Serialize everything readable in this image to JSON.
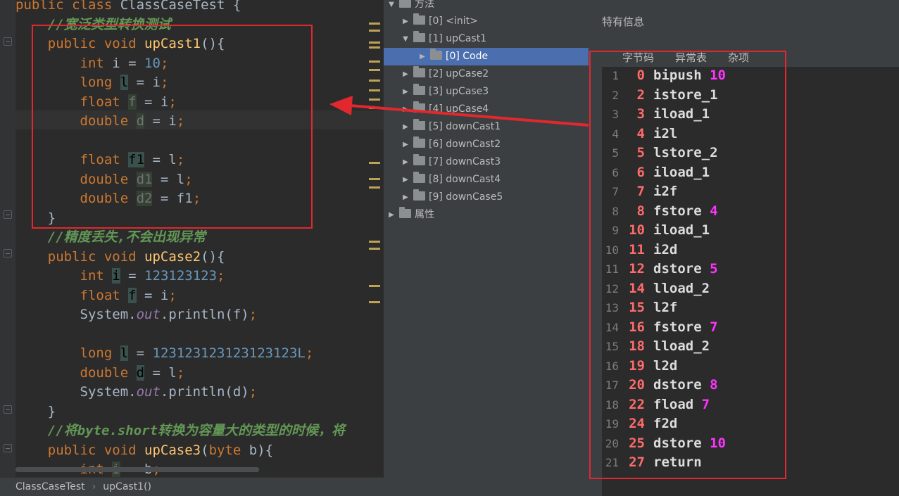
{
  "editor": {
    "code_lines": [
      [
        [
          "kw",
          "public "
        ],
        [
          "kw",
          "class "
        ],
        [
          "id",
          "ClassCaseTest {"
        ]
      ],
      [
        [
          "id",
          "    "
        ],
        [
          "cm",
          "//宽泛类型转换测试"
        ]
      ],
      [
        [
          "id",
          "    "
        ],
        [
          "kw",
          "public "
        ],
        [
          "kw",
          "void "
        ],
        [
          "fn",
          "upCast1"
        ],
        [
          "id",
          "(){"
        ]
      ],
      [
        [
          "id",
          "        "
        ],
        [
          "kw",
          "int "
        ],
        [
          "id",
          "i = "
        ],
        [
          "num",
          "10"
        ],
        [
          "kw",
          ";"
        ]
      ],
      [
        [
          "id",
          "        "
        ],
        [
          "kw",
          "long "
        ],
        [
          "hl",
          "l"
        ],
        [
          "id",
          " = i"
        ],
        [
          "kw",
          ";"
        ]
      ],
      [
        [
          "id",
          "        "
        ],
        [
          "kw",
          "float "
        ],
        [
          "unused",
          "f"
        ],
        [
          "id",
          " = i"
        ],
        [
          "kw",
          ";"
        ]
      ],
      [
        [
          "id",
          "        "
        ],
        [
          "kw",
          "double "
        ],
        [
          "unused",
          "d"
        ],
        [
          "id",
          " = i"
        ],
        [
          "kw",
          ";"
        ]
      ],
      [
        [
          "id",
          ""
        ]
      ],
      [
        [
          "id",
          "        "
        ],
        [
          "kw",
          "float "
        ],
        [
          "hl",
          "f1"
        ],
        [
          "id",
          " = l"
        ],
        [
          "kw",
          ";"
        ]
      ],
      [
        [
          "id",
          "        "
        ],
        [
          "kw",
          "double "
        ],
        [
          "unused",
          "d1"
        ],
        [
          "id",
          " = l"
        ],
        [
          "kw",
          ";"
        ]
      ],
      [
        [
          "id",
          "        "
        ],
        [
          "kw",
          "double "
        ],
        [
          "unused",
          "d2"
        ],
        [
          "id",
          " = f1"
        ],
        [
          "kw",
          ";"
        ]
      ],
      [
        [
          "id",
          "    }"
        ]
      ],
      [
        [
          "id",
          "    "
        ],
        [
          "cm",
          "//精度丢失,不会出现异常"
        ]
      ],
      [
        [
          "id",
          "    "
        ],
        [
          "kw",
          "public "
        ],
        [
          "kw",
          "void "
        ],
        [
          "fn",
          "upCase2"
        ],
        [
          "id",
          "(){"
        ]
      ],
      [
        [
          "id",
          "        "
        ],
        [
          "kw",
          "int "
        ],
        [
          "hl",
          "i"
        ],
        [
          "id",
          " = "
        ],
        [
          "num",
          "123123123"
        ],
        [
          "kw",
          ";"
        ]
      ],
      [
        [
          "id",
          "        "
        ],
        [
          "kw",
          "float "
        ],
        [
          "hl",
          "f"
        ],
        [
          "id",
          " = i"
        ],
        [
          "kw",
          ";"
        ]
      ],
      [
        [
          "id",
          "        System."
        ],
        [
          "fld",
          "out"
        ],
        [
          "id",
          ".println(f)"
        ],
        [
          "kw",
          ";"
        ]
      ],
      [
        [
          "id",
          ""
        ]
      ],
      [
        [
          "id",
          "        "
        ],
        [
          "kw",
          "long "
        ],
        [
          "hl",
          "l"
        ],
        [
          "id",
          " = "
        ],
        [
          "num",
          "123123123123123123L"
        ],
        [
          "kw",
          ";"
        ]
      ],
      [
        [
          "id",
          "        "
        ],
        [
          "kw",
          "double "
        ],
        [
          "hl",
          "d"
        ],
        [
          "id",
          " = l"
        ],
        [
          "kw",
          ";"
        ]
      ],
      [
        [
          "id",
          "        System."
        ],
        [
          "fld",
          "out"
        ],
        [
          "id",
          ".println(d)"
        ],
        [
          "kw",
          ";"
        ]
      ],
      [
        [
          "id",
          "    }"
        ]
      ],
      [
        [
          "id",
          "    "
        ],
        [
          "cm",
          "//将byte.short转换为容量大的类型的时候，将"
        ]
      ],
      [
        [
          "id",
          "    "
        ],
        [
          "kw",
          "public "
        ],
        [
          "kw",
          "void "
        ],
        [
          "fn",
          "upCase3"
        ],
        [
          "id",
          "("
        ],
        [
          "kw",
          "byte "
        ],
        [
          "id",
          "b){"
        ]
      ],
      [
        [
          "id",
          "        "
        ],
        [
          "kw",
          "int "
        ],
        [
          "unused",
          "i"
        ],
        [
          "id",
          " = b"
        ],
        [
          "kw",
          ";"
        ]
      ]
    ]
  },
  "breadcrumb": {
    "class_name": "ClassCaseTest",
    "method_name": "upCast1()"
  },
  "tree": {
    "root_label": "方法",
    "items": [
      {
        "label": "[0] <init>",
        "expanded": false,
        "selected": false
      },
      {
        "label": "[1] upCast1",
        "expanded": true,
        "selected": false
      },
      {
        "label": "[0] Code",
        "expanded": false,
        "selected": true
      },
      {
        "label": "[2] upCase2",
        "expanded": false,
        "selected": false
      },
      {
        "label": "[3] upCase3",
        "expanded": false,
        "selected": false
      },
      {
        "label": "[4] upCase4",
        "expanded": false,
        "selected": false
      },
      {
        "label": "[5] downCast1",
        "expanded": false,
        "selected": false
      },
      {
        "label": "[6] downCast2",
        "expanded": false,
        "selected": false
      },
      {
        "label": "[7] downCast3",
        "expanded": false,
        "selected": false
      },
      {
        "label": "[8] downCast4",
        "expanded": false,
        "selected": false
      },
      {
        "label": "[9] downCase5",
        "expanded": false,
        "selected": false
      },
      {
        "label": "属性",
        "expanded": false,
        "selected": false
      }
    ]
  },
  "detail": {
    "title": "特有信息",
    "tabs": [
      "字节码",
      "异常表",
      "杂项"
    ],
    "active_tab": "字节码",
    "bytecode": [
      {
        "ln": "1",
        "offset": "0",
        "op": "bipush",
        "arg": "10"
      },
      {
        "ln": "2",
        "offset": "2",
        "op": "istore_1",
        "arg": ""
      },
      {
        "ln": "3",
        "offset": "3",
        "op": "iload_1",
        "arg": ""
      },
      {
        "ln": "4",
        "offset": "4",
        "op": "i2l",
        "arg": ""
      },
      {
        "ln": "5",
        "offset": "5",
        "op": "lstore_2",
        "arg": ""
      },
      {
        "ln": "6",
        "offset": "6",
        "op": "iload_1",
        "arg": ""
      },
      {
        "ln": "7",
        "offset": "7",
        "op": "i2f",
        "arg": ""
      },
      {
        "ln": "8",
        "offset": "8",
        "op": "fstore",
        "arg": "4"
      },
      {
        "ln": "9",
        "offset": "10",
        "op": "iload_1",
        "arg": ""
      },
      {
        "ln": "10",
        "offset": "11",
        "op": "i2d",
        "arg": ""
      },
      {
        "ln": "11",
        "offset": "12",
        "op": "dstore",
        "arg": "5"
      },
      {
        "ln": "12",
        "offset": "14",
        "op": "lload_2",
        "arg": ""
      },
      {
        "ln": "13",
        "offset": "15",
        "op": "l2f",
        "arg": ""
      },
      {
        "ln": "14",
        "offset": "16",
        "op": "fstore",
        "arg": "7"
      },
      {
        "ln": "15",
        "offset": "18",
        "op": "lload_2",
        "arg": ""
      },
      {
        "ln": "16",
        "offset": "19",
        "op": "l2d",
        "arg": ""
      },
      {
        "ln": "17",
        "offset": "20",
        "op": "dstore",
        "arg": "8"
      },
      {
        "ln": "18",
        "offset": "22",
        "op": "fload",
        "arg": "7"
      },
      {
        "ln": "19",
        "offset": "24",
        "op": "f2d",
        "arg": ""
      },
      {
        "ln": "20",
        "offset": "25",
        "op": "dstore",
        "arg": "10"
      },
      {
        "ln": "21",
        "offset": "27",
        "op": "return",
        "arg": ""
      }
    ]
  },
  "colors": {
    "annotation_red": "#e0282e",
    "keyword": "#cc7832",
    "comment": "#629755",
    "number": "#6897bb",
    "method_name": "#ffc66d",
    "selection_blue": "#4b6eaf",
    "bytecode_offset": "#ff6b6b",
    "bytecode_arg": "#ff33ff"
  }
}
